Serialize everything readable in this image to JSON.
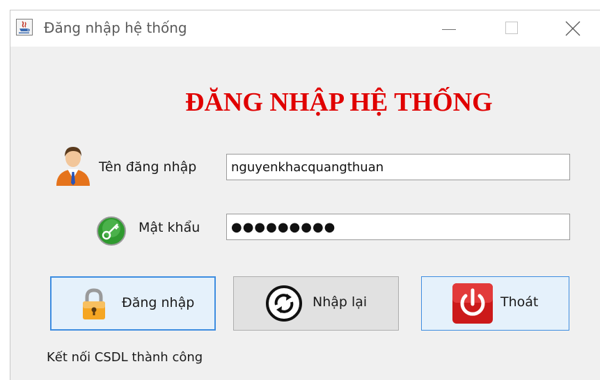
{
  "window": {
    "title": "Đăng nhập hệ thống",
    "controls": {
      "minimize": "minimize-icon",
      "maximize": "maximize-icon",
      "close": "close-icon"
    }
  },
  "form": {
    "heading": "ĐĂNG NHẬP HỆ THỐNG",
    "username_label": "Tên đăng nhập",
    "username_value": "nguyenkhacquangthuan",
    "password_label": "Mật khẩu",
    "password_value": "●●●●●●●●●"
  },
  "buttons": {
    "login": {
      "label": "Đăng nhập",
      "icon": "lock-icon"
    },
    "reset": {
      "label": "Nhập lại",
      "icon": "refresh-icon"
    },
    "exit": {
      "label": "Thoát",
      "icon": "power-icon"
    }
  },
  "status": {
    "text": "Kết nối CSDL thành công"
  },
  "colors": {
    "heading": "#e00000",
    "focused_button_border": "#3c8ce0",
    "exit_icon": "#cc1a1a"
  }
}
